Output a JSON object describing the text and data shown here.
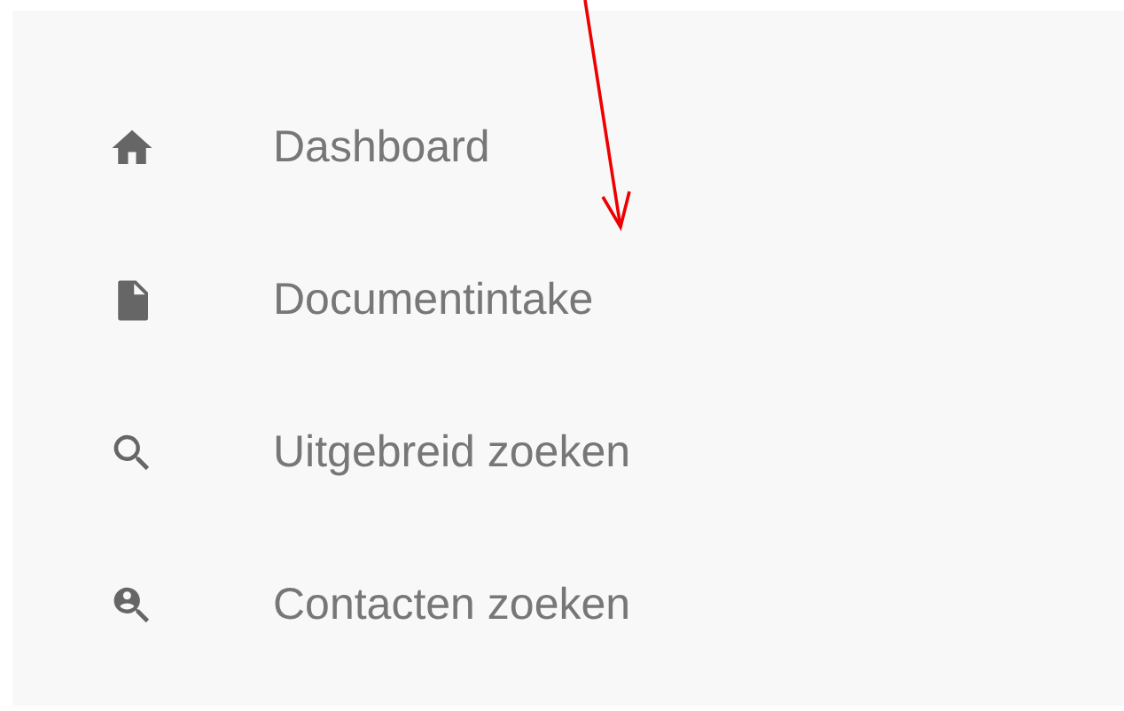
{
  "menu": {
    "items": [
      {
        "label": "Dashboard"
      },
      {
        "label": "Documentintake"
      },
      {
        "label": "Uitgebreid zoeken"
      },
      {
        "label": "Contacten zoeken"
      }
    ]
  }
}
